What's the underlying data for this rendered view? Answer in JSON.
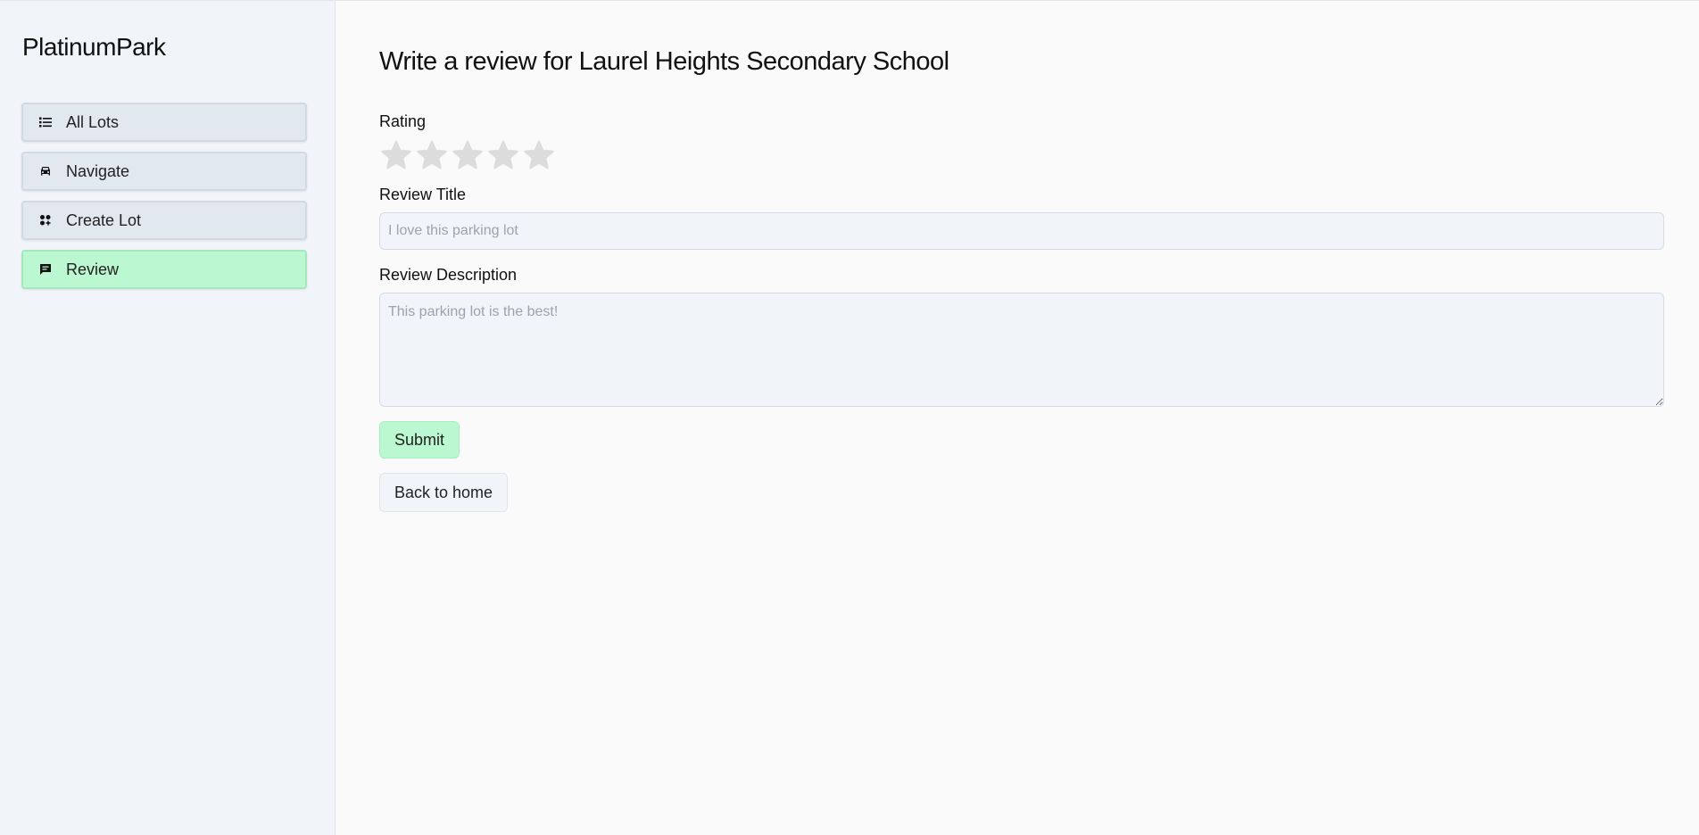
{
  "brand": "PlatinumPark",
  "nav": [
    {
      "label": "All Lots",
      "icon": "list-icon",
      "active": false
    },
    {
      "label": "Navigate",
      "icon": "car-icon",
      "active": false
    },
    {
      "label": "Create Lot",
      "icon": "grid-plus-icon",
      "active": false
    },
    {
      "label": "Review",
      "icon": "chat-icon",
      "active": true
    }
  ],
  "page": {
    "title": "Write a review for Laurel Heights Secondary School"
  },
  "form": {
    "rating_label": "Rating",
    "rating_value": 0,
    "rating_max": 5,
    "title_label": "Review Title",
    "title_placeholder": "I love this parking lot",
    "title_value": "",
    "description_label": "Review Description",
    "description_placeholder": "This parking lot is the best!",
    "description_value": "",
    "submit_label": "Submit",
    "back_label": "Back to home"
  },
  "colors": {
    "active_nav": "#bbf7d0",
    "nav_bg": "#e2e8f0",
    "star_empty": "#dcdcdc"
  }
}
